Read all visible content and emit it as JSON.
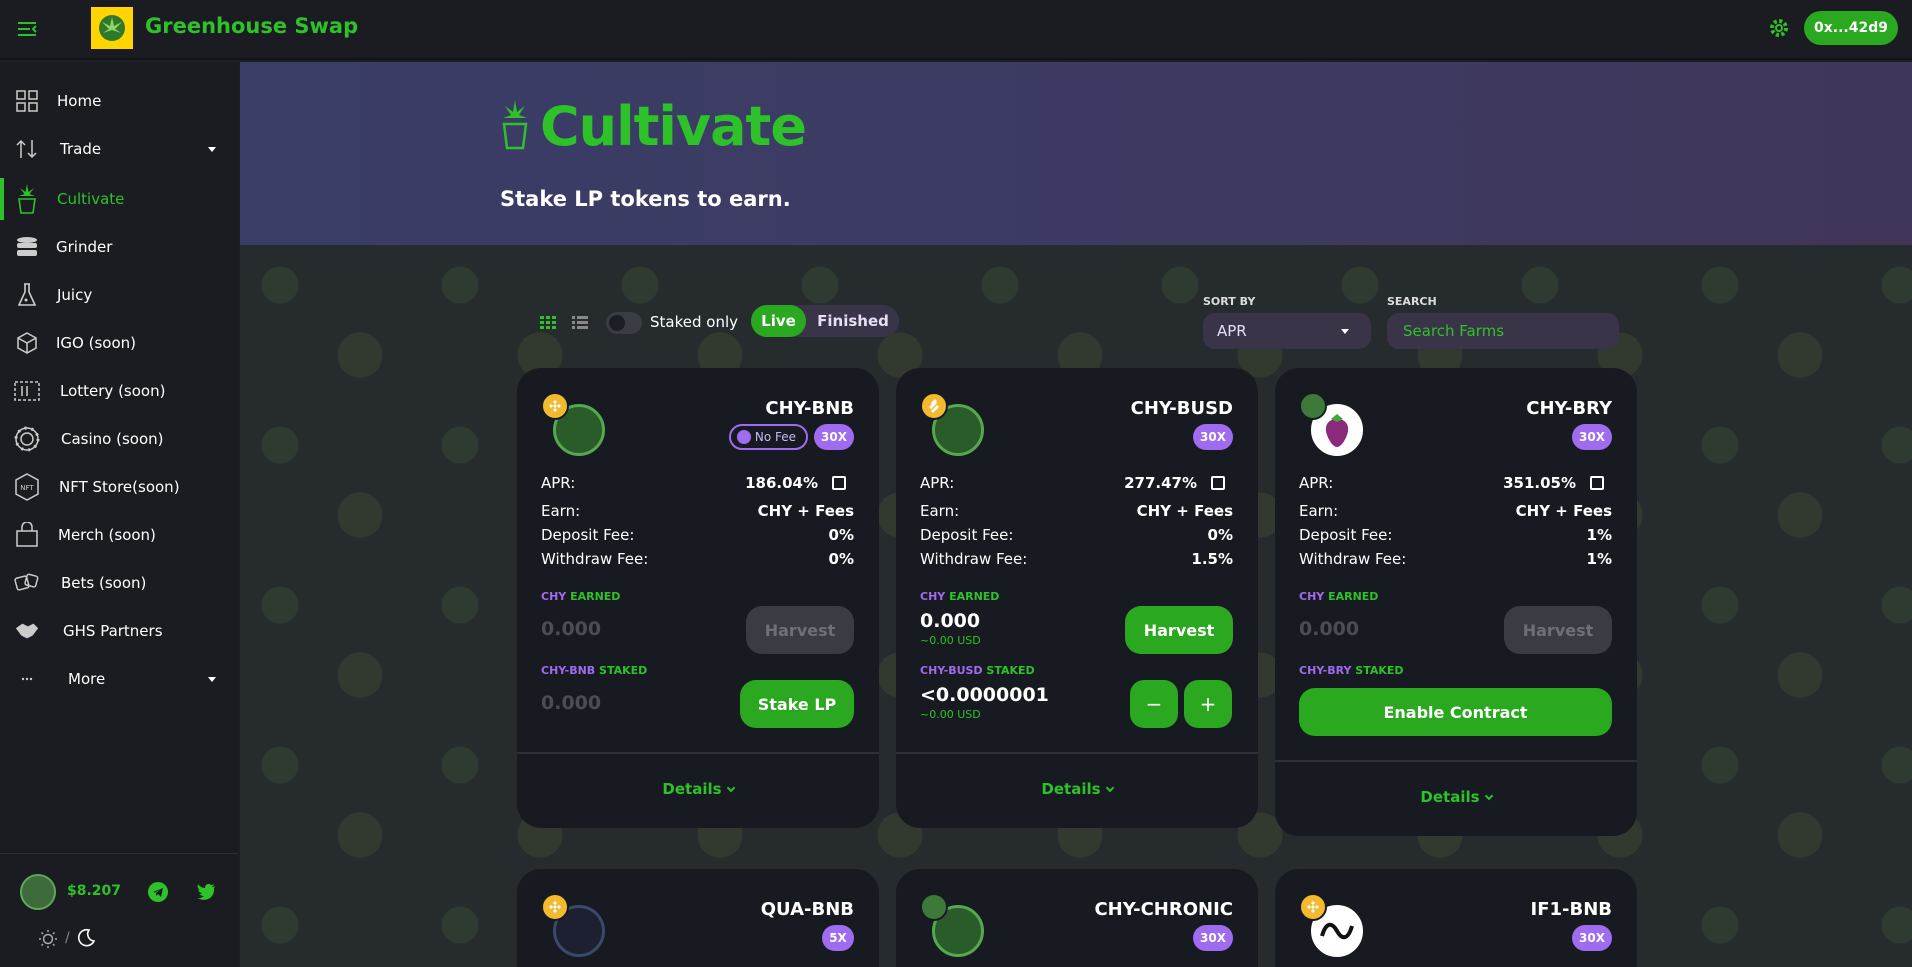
{
  "header": {
    "brand": "Greenhouse Swap",
    "wallet": "0x...42d9"
  },
  "sidebar": {
    "items": [
      {
        "label": "Home",
        "icon": "grid-icon"
      },
      {
        "label": "Trade",
        "icon": "swap-arrows-icon"
      },
      {
        "label": "Cultivate",
        "icon": "cannabis-pot-icon"
      },
      {
        "label": "Grinder",
        "icon": "grinder-icon"
      },
      {
        "label": "Juicy",
        "icon": "flask-icon"
      },
      {
        "label": "IGO (soon)",
        "icon": "cube-icon"
      },
      {
        "label": "Lottery (soon)",
        "icon": "ticket-icon"
      },
      {
        "label": "Casino (soon)",
        "icon": "chip-icon"
      },
      {
        "label": "NFT Store(soon)",
        "icon": "nft-icon"
      },
      {
        "label": "Merch (soon)",
        "icon": "bag-icon"
      },
      {
        "label": "Bets (soon)",
        "icon": "dice-icon"
      },
      {
        "label": "GHS Partners",
        "icon": "handshake-icon"
      },
      {
        "label": "More",
        "icon": "dots-icon"
      }
    ],
    "price": "$8.207"
  },
  "hero": {
    "title": "Cultivate",
    "subtitle": "Stake LP tokens to earn."
  },
  "controls": {
    "staked_only": "Staked only",
    "live": "Live",
    "finished": "Finished",
    "sort_by_label": "SORT BY",
    "sort_value": "APR",
    "search_label": "SEARCH",
    "search_placeholder": "Search Farms"
  },
  "labels": {
    "apr": "APR:",
    "earn": "Earn:",
    "deposit_fee": "Deposit Fee:",
    "withdraw_fee": "Withdraw Fee:",
    "earned_token": "CHY",
    "earned_word": "EARNED",
    "staked_word": "STAKED",
    "details": "Details",
    "harvest": "Harvest",
    "stake_lp": "Stake LP",
    "enable_contract": "Enable Contract",
    "minus": "−",
    "plus": "+",
    "no_fee": "No Fee"
  },
  "farms": [
    {
      "pair": "CHY-BNB",
      "multiplier": "30X",
      "apr": "186.04%",
      "earn": "CHY + Fees",
      "deposit_fee": "0%",
      "withdraw_fee": "0%",
      "earned": "0.000",
      "staked": "0.000"
    },
    {
      "pair": "CHY-BUSD",
      "multiplier": "30X",
      "apr": "277.47%",
      "earn": "CHY + Fees",
      "deposit_fee": "0%",
      "withdraw_fee": "1.5%",
      "earned": "0.000",
      "earned_usd": "~0.00 USD",
      "staked": "<0.0000001",
      "staked_usd": "~0.00 USD"
    },
    {
      "pair": "CHY-BRY",
      "multiplier": "30X",
      "apr": "351.05%",
      "earn": "CHY + Fees",
      "deposit_fee": "1%",
      "withdraw_fee": "1%",
      "earned": "0.000"
    },
    {
      "pair": "QUA-BNB",
      "multiplier": "5X"
    },
    {
      "pair": "CHY-CHRONIC",
      "multiplier": "30X"
    },
    {
      "pair": "IF1-BNB",
      "multiplier": "30X"
    }
  ],
  "colors": {
    "accent_green": "#2ec22a",
    "button_green": "#2aa81f",
    "badge_purple": "#9f6cf0"
  }
}
